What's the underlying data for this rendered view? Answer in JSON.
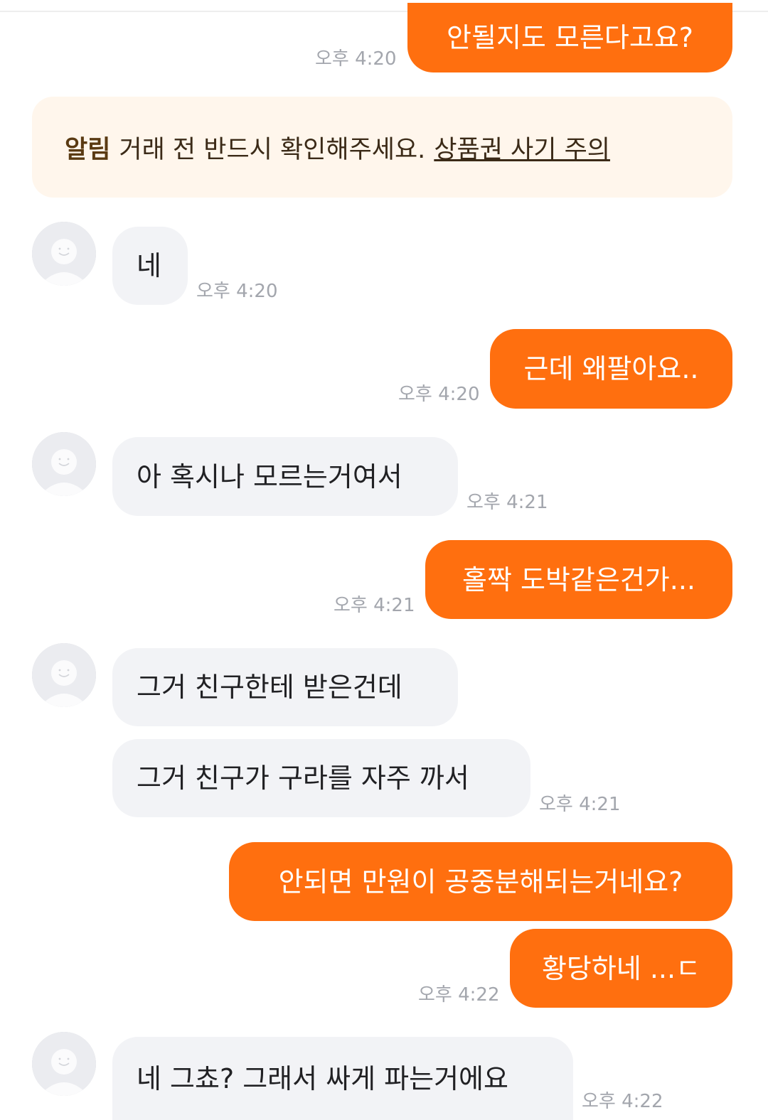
{
  "notice": {
    "label": "알림",
    "text": "거래 전 반드시 확인해주세요.",
    "link": "상품권 사기 주의"
  },
  "messages": [
    {
      "from": "me",
      "text": "안될지도 모른다고요?",
      "time": "오후 4:20"
    },
    {
      "from": "other",
      "text": "네",
      "time": "오후 4:20"
    },
    {
      "from": "me",
      "text": "근데 왜팔아요..",
      "time": "오후 4:20"
    },
    {
      "from": "other",
      "text": "아 혹시나 모르는거여서",
      "time": "오후 4:21"
    },
    {
      "from": "me",
      "text": "홀짝 도박같은건가...",
      "time": "오후 4:21"
    },
    {
      "from": "other",
      "text": "그거 친구한테 받은건데",
      "time": ""
    },
    {
      "from": "other",
      "text": "그거 친구가 구라를 자주 까서",
      "time": "오후 4:21"
    },
    {
      "from": "me",
      "text": "안되면 만원이 공중분해되는거네요?",
      "time": ""
    },
    {
      "from": "me",
      "text": "황당하네 ...ㄷ",
      "time": "오후 4:22"
    },
    {
      "from": "other",
      "text": "네 그쵸? 그래서 싸게 파는거에요",
      "time": "오후 4:22"
    }
  ],
  "colors": {
    "accent": "#ff6f0f",
    "other_bubble": "#f2f3f6",
    "notice_bg": "#fff6ec",
    "time_text": "#a3a6ad"
  }
}
